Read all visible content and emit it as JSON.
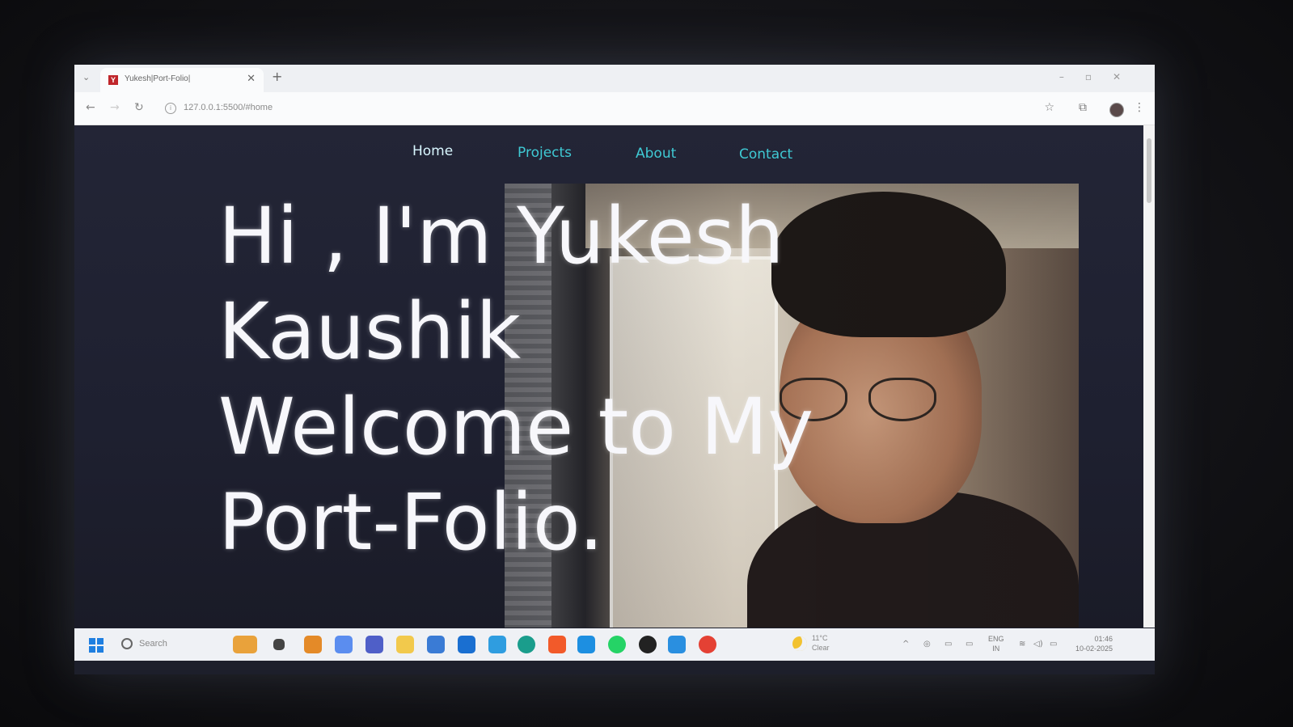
{
  "browser": {
    "tab_title": "Yukesh|Port-Folio|",
    "favicon": "Y",
    "address": "127.0.0.1:5500/#home"
  },
  "nav": {
    "items": [
      {
        "label": "Home",
        "active": true
      },
      {
        "label": "Projects",
        "active": false
      },
      {
        "label": "About",
        "active": false
      },
      {
        "label": "Contact",
        "active": false
      }
    ]
  },
  "hero": {
    "lines": [
      "Hi , I'm Yukesh",
      "Kaushik",
      "Welcome to My",
      "Port-Folio."
    ]
  },
  "taskbar": {
    "search_placeholder": "Search",
    "weather_temp": "11°C",
    "weather_desc": "Clear",
    "lang_top": "ENG",
    "lang_bottom": "IN",
    "time": "01:46",
    "date": "10-02-2025"
  },
  "colors": {
    "nav_link": "#3fc9d4",
    "nav_active": "#d8f6ff",
    "page_bg": "#1e2030",
    "hero_text": "#f7f7fb"
  },
  "icons": [
    "chevron-down-icon",
    "close-icon",
    "plus-icon",
    "back-icon",
    "forward-icon",
    "reload-icon",
    "info-icon",
    "star-icon",
    "extensions-icon",
    "profile-icon",
    "menu-icon",
    "windows-icon",
    "search-icon",
    "weather-icon",
    "wifi-icon",
    "volume-icon",
    "battery-icon"
  ]
}
